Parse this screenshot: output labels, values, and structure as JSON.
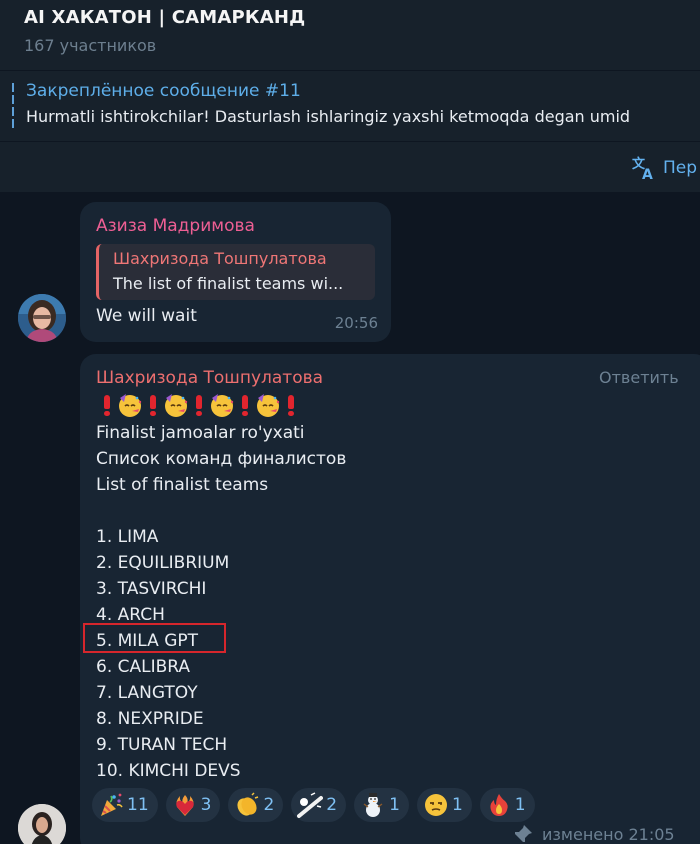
{
  "header": {
    "title": "AI ХАКАТОН | САМАРКАНД",
    "subtitle": "167 участников"
  },
  "pinned": {
    "title": "Закреплённое сообщение #11",
    "text": "Hurmatli ishtirokchilar!  Dasturlash ishlaringiz yaxshi ketmoqda degan umid"
  },
  "translate": {
    "label": "Пер",
    "icon": "translate-icon"
  },
  "messages": [
    {
      "sender": "Азиза Мадримова",
      "reply": {
        "author": "Шахризода Тошпулатова",
        "text": "The list of finalist teams wi..."
      },
      "text": "We will wait",
      "time": "20:56"
    },
    {
      "sender": "Шахризода Тошпулатова",
      "reply_label": "Ответить",
      "emoji_line": [
        "exclamation",
        "partying-face",
        "exclamation",
        "partying-face",
        "exclamation",
        "partying-face",
        "exclamation",
        "partying-face",
        "exclamation"
      ],
      "lines": [
        "Finalist jamoalar ro'yxati",
        "Список команд финалистов",
        "List of finalist teams",
        "",
        "1. LIMA",
        "2. EQUILIBRIUM",
        "3. TASVIRCHI",
        "4. ARCH",
        "5. MILA GPT",
        "6. CALIBRA",
        "7. LANGTOY",
        "8. NEXPRIDE",
        "9. TURAN TECH",
        "10. KIMCHI DEVS"
      ],
      "reactions": [
        {
          "icon": "party-popper",
          "count": "11"
        },
        {
          "icon": "heart-on-fire",
          "count": "3"
        },
        {
          "icon": "clapping-hands",
          "count": "2"
        },
        {
          "icon": "cue-ball",
          "count": "2"
        },
        {
          "icon": "snowman",
          "count": "1"
        },
        {
          "icon": "unamused-face",
          "count": "1"
        },
        {
          "icon": "fire",
          "count": "1"
        }
      ],
      "edited": "изменено 21:05"
    }
  ],
  "colors": {
    "background": "#0e1621",
    "header": "#17212b",
    "bubble": "#182533",
    "accent": "#5eaee9",
    "highlight_box": "#d6262c"
  }
}
